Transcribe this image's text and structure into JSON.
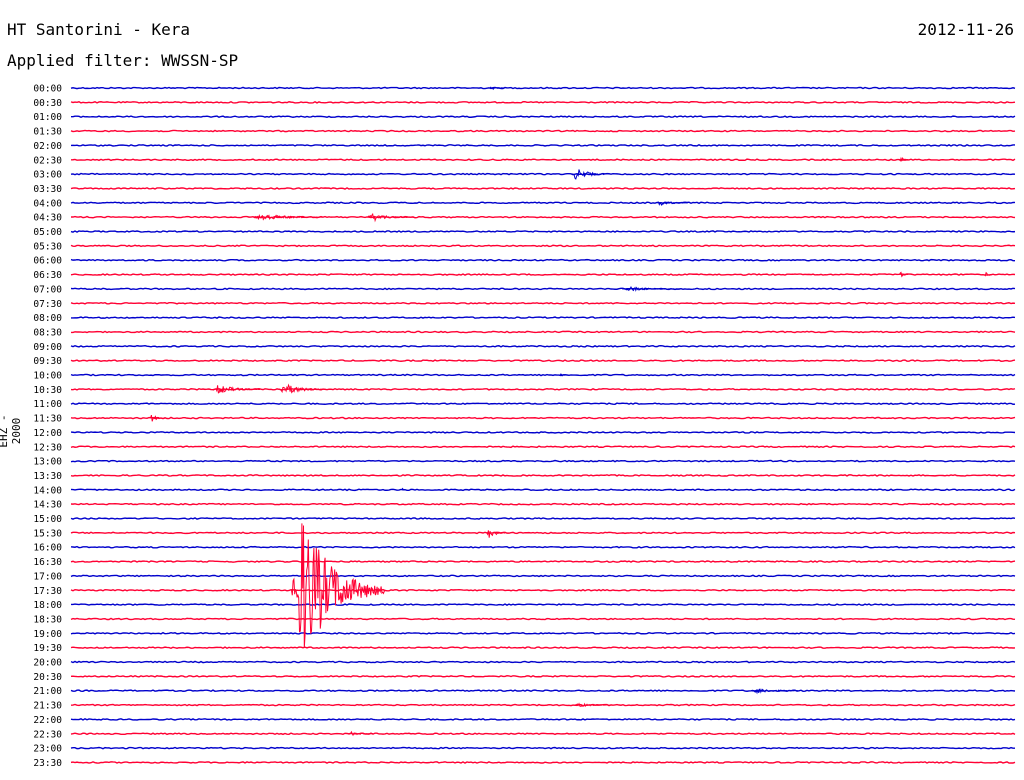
{
  "header": {
    "title": "HT Santorini - Kera",
    "date": "2012-11-26",
    "filter": "Applied filter: WWSSN-SP"
  },
  "colors": {
    "even": "#0000cc",
    "odd": "#ff0033",
    "text": "#000000"
  },
  "chart_data": {
    "type": "line",
    "title": "HT Santorini - Kera",
    "ylabel": "EHZ - 2000",
    "rows": [
      "00:00",
      "00:30",
      "01:00",
      "01:30",
      "02:00",
      "02:30",
      "03:00",
      "03:30",
      "04:00",
      "04:30",
      "05:00",
      "05:30",
      "06:00",
      "06:30",
      "07:00",
      "07:30",
      "08:00",
      "08:30",
      "09:00",
      "09:30",
      "10:00",
      "10:30",
      "11:00",
      "11:30",
      "12:00",
      "12:30",
      "13:00",
      "13:30",
      "14:00",
      "14:30",
      "15:00",
      "15:30",
      "16:00",
      "16:30",
      "17:00",
      "17:30",
      "18:00",
      "18:30",
      "19:00",
      "19:30",
      "20:00",
      "20:30",
      "21:00",
      "21:30",
      "22:00",
      "22:30",
      "23:00",
      "23:30"
    ],
    "x_range_minutes": [
      0,
      30
    ],
    "events": [
      {
        "row": "00:00",
        "minute": 13.3,
        "amplitude": 2,
        "duration_min": 0.5
      },
      {
        "row": "02:30",
        "minute": 26.3,
        "amplitude": 4,
        "duration_min": 0.3
      },
      {
        "row": "03:00",
        "minute": 15.9,
        "amplitude": 6,
        "duration_min": 1.2
      },
      {
        "row": "04:00",
        "minute": 18.6,
        "amplitude": 3,
        "duration_min": 1.0
      },
      {
        "row": "04:30",
        "minute": 5.8,
        "amplitude": 4,
        "duration_min": 2.2
      },
      {
        "row": "04:30",
        "minute": 9.4,
        "amplitude": 4,
        "duration_min": 1.5
      },
      {
        "row": "06:30",
        "minute": 26.3,
        "amplitude": 3,
        "duration_min": 0.3
      },
      {
        "row": "06:30",
        "minute": 29.0,
        "amplitude": 3,
        "duration_min": 0.3
      },
      {
        "row": "07:00",
        "minute": 17.5,
        "amplitude": 2,
        "duration_min": 2.0
      },
      {
        "row": "10:00",
        "minute": 15.5,
        "amplitude": 3,
        "duration_min": 0.2
      },
      {
        "row": "10:30",
        "minute": 4.5,
        "amplitude": 5,
        "duration_min": 1.5
      },
      {
        "row": "10:30",
        "minute": 6.6,
        "amplitude": 6,
        "duration_min": 1.5
      },
      {
        "row": "11:30",
        "minute": 2.5,
        "amplitude": 5,
        "duration_min": 0.5
      },
      {
        "row": "14:00",
        "minute": 10.5,
        "amplitude": 3,
        "duration_min": 0.1
      },
      {
        "row": "15:30",
        "minute": 13.2,
        "amplitude": 6,
        "duration_min": 0.6
      },
      {
        "row": "17:30",
        "minute": 7.0,
        "amplitude": 75,
        "duration_min": 3.0
      },
      {
        "row": "21:00",
        "minute": 21.6,
        "amplitude": 3,
        "duration_min": 1.5
      },
      {
        "row": "21:30",
        "minute": 16.0,
        "amplitude": 2,
        "duration_min": 1.2
      },
      {
        "row": "22:30",
        "minute": 8.8,
        "amplitude": 2,
        "duration_min": 0.8
      }
    ]
  }
}
